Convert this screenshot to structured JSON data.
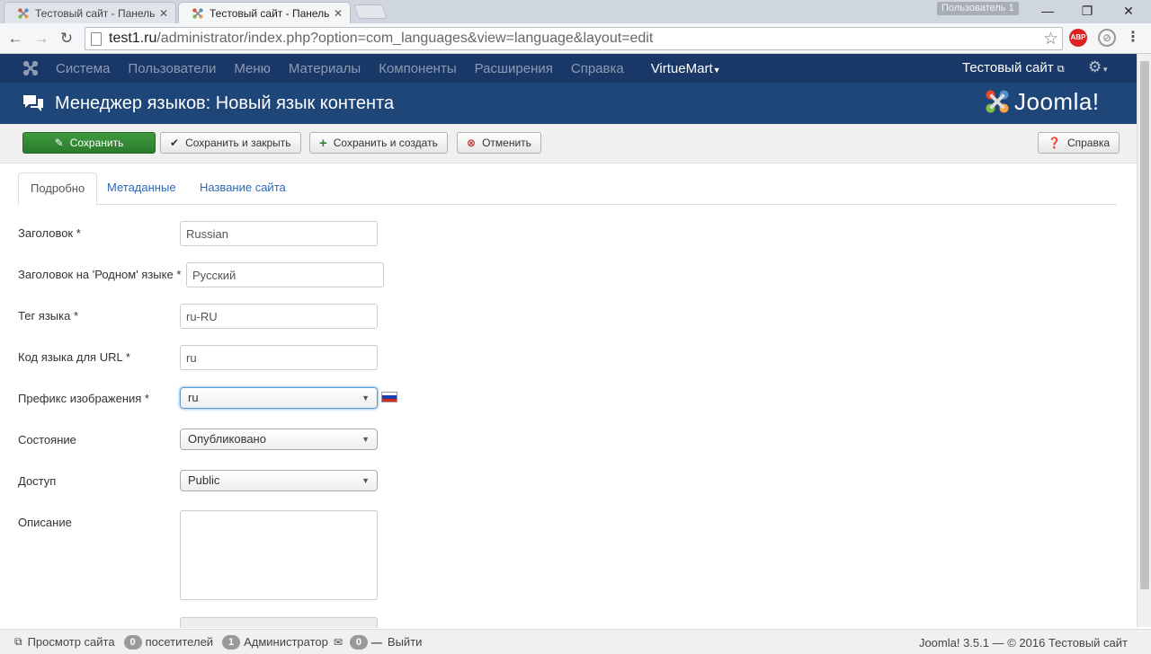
{
  "browser": {
    "tabs": [
      {
        "title": "Тестовый сайт - Панель у"
      },
      {
        "title": "Тестовый сайт - Панель у"
      }
    ],
    "profile_name": "Пользователь 1",
    "url_host": "test1.ru",
    "url_path": "/administrator/index.php?option=com_languages&view=language&layout=edit",
    "ext_abp": "ABP"
  },
  "topnav": {
    "items": [
      "Система",
      "Пользователи",
      "Меню",
      "Материалы",
      "Компоненты",
      "Расширения",
      "Справка"
    ],
    "virtuemart": "VirtueMart",
    "site": "Тестовый сайт"
  },
  "header": {
    "title": "Менеджер языков: Новый язык контента",
    "brand": "Joomla!"
  },
  "toolbar": {
    "save": "Сохранить",
    "save_close": "Сохранить и закрыть",
    "save_new": "Сохранить и создать",
    "cancel": "Отменить",
    "help": "Справка"
  },
  "tabs": [
    "Подробно",
    "Метаданные",
    "Название сайта"
  ],
  "form": {
    "title_label": "Заголовок *",
    "title_value": "Russian",
    "native_label": "Заголовок на 'Родном' языке *",
    "native_value": "Русский",
    "tag_label": "Тег языка *",
    "tag_value": "ru-RU",
    "sef_label": "Код языка для URL *",
    "sef_value": "ru",
    "image_label": "Префикс изображения *",
    "image_value": "ru",
    "state_label": "Состояние",
    "state_value": "Опубликовано",
    "access_label": "Доступ",
    "access_value": "Public",
    "desc_label": "Описание",
    "desc_value": ""
  },
  "footer": {
    "view_site": "Просмотр сайта",
    "visitors_count": "0",
    "visitors": "посетителей",
    "admins_count": "1",
    "admins": "Администратор",
    "messages_count": "0",
    "logout": "Выйти",
    "version": "Joomla! 3.5.1",
    "copyright": "— © 2016 Тестовый сайт"
  },
  "colors": {
    "topnav_bg": "#1a3867",
    "header_bg": "#1e4679",
    "save_green": "#2f7d32"
  },
  "icons": {
    "favicon": "joomla-icon",
    "header": "comments-icon",
    "save": "edit-icon",
    "save_close": "check-icon",
    "save_new": "plus-icon",
    "cancel": "cancel-icon",
    "help": "question-icon"
  }
}
